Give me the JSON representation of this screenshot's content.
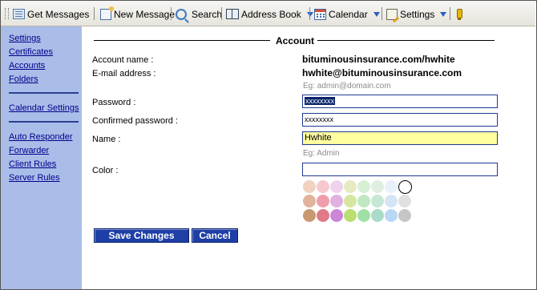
{
  "toolbar": {
    "items": [
      {
        "label": "Get Messages",
        "icon": "get-messages-icon"
      },
      {
        "label": "New Message",
        "icon": "new-message-icon"
      },
      {
        "label": "Search",
        "icon": "search-icon"
      },
      {
        "label": "Address Book",
        "icon": "address-book-icon"
      },
      {
        "label": "Calendar",
        "icon": "calendar-icon"
      },
      {
        "label": "Settings",
        "icon": "settings-icon"
      }
    ],
    "help_icon": "help-icon"
  },
  "sidebar": {
    "items": [
      "Settings",
      "Certificates",
      "Accounts",
      "Folders",
      "Calendar Settings",
      "Auto Responder",
      "Forwarder",
      "Client Rules",
      "Server Rules"
    ]
  },
  "section": {
    "title": "Account"
  },
  "form": {
    "account_name_label": "Account name :",
    "account_name_value": "bituminousinsurance.com/hwhite",
    "email_label": "E-mail address :",
    "email_value": "hwhite@bituminousinsurance.com",
    "email_hint": "Eg: admin@domain.com",
    "password_label": "Password :",
    "password_value": "xxxxxxxx",
    "confirm_label": "Confirmed password :",
    "confirm_value": "xxxxxxxx",
    "name_label": "Name :",
    "name_value": "Hwhite",
    "name_hint": "Eg: Admin",
    "color_label": "Color :",
    "color_value": ""
  },
  "palette": {
    "rows": [
      [
        "#f0d2c0",
        "#f6c8cf",
        "#f0d2ee",
        "#e6eac0",
        "#d6f0d6",
        "#e0eee0",
        "#e8f0fa",
        "outline"
      ],
      [
        "#e0b49a",
        "#ee9eaa",
        "#e0b0e0",
        "#d6e6a0",
        "#c0e8c0",
        "#c6e6d6",
        "#d4e6f6",
        "#e0e0e0"
      ],
      [
        "#c89870",
        "#e07a86",
        "#cc86d6",
        "#bade70",
        "#a0e0a6",
        "#a8dcc8",
        "#b8d8f6",
        "#c6c6c6"
      ]
    ]
  },
  "buttons": {
    "save": "Save Changes",
    "cancel": "Cancel"
  },
  "colors": {
    "sidebar_bg": "#a9bde8",
    "button_bg": "#1d3fa6",
    "link": "#00008b",
    "name_field_bg": "#ffffa0"
  }
}
